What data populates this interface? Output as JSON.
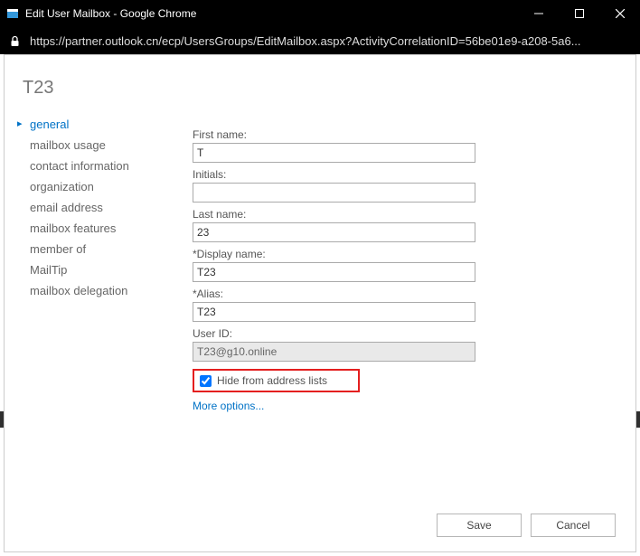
{
  "window": {
    "title": "Edit User Mailbox - Google Chrome",
    "url": "https://partner.outlook.cn/ecp/UsersGroups/EditMailbox.aspx?ActivityCorrelationID=56be01e9-a208-5a6..."
  },
  "page_heading": "T23",
  "sidebar": {
    "items": [
      {
        "label": "general",
        "active": true
      },
      {
        "label": "mailbox usage",
        "active": false
      },
      {
        "label": "contact information",
        "active": false
      },
      {
        "label": "organization",
        "active": false
      },
      {
        "label": "email address",
        "active": false
      },
      {
        "label": "mailbox features",
        "active": false
      },
      {
        "label": "member of",
        "active": false
      },
      {
        "label": "MailTip",
        "active": false
      },
      {
        "label": "mailbox delegation",
        "active": false
      }
    ]
  },
  "form": {
    "first_name": {
      "label": "First name:",
      "value": "T"
    },
    "initials": {
      "label": "Initials:",
      "value": ""
    },
    "last_name": {
      "label": "Last name:",
      "value": "23"
    },
    "display_name": {
      "label": "*Display name:",
      "value": "T23"
    },
    "alias": {
      "label": "*Alias:",
      "value": "T23"
    },
    "user_id": {
      "label": "User ID:",
      "value": "T23@g10.online"
    },
    "hide_from_lists": {
      "label": "Hide from address lists",
      "checked": true
    },
    "more_options": "More options..."
  },
  "buttons": {
    "save": "Save",
    "cancel": "Cancel"
  }
}
